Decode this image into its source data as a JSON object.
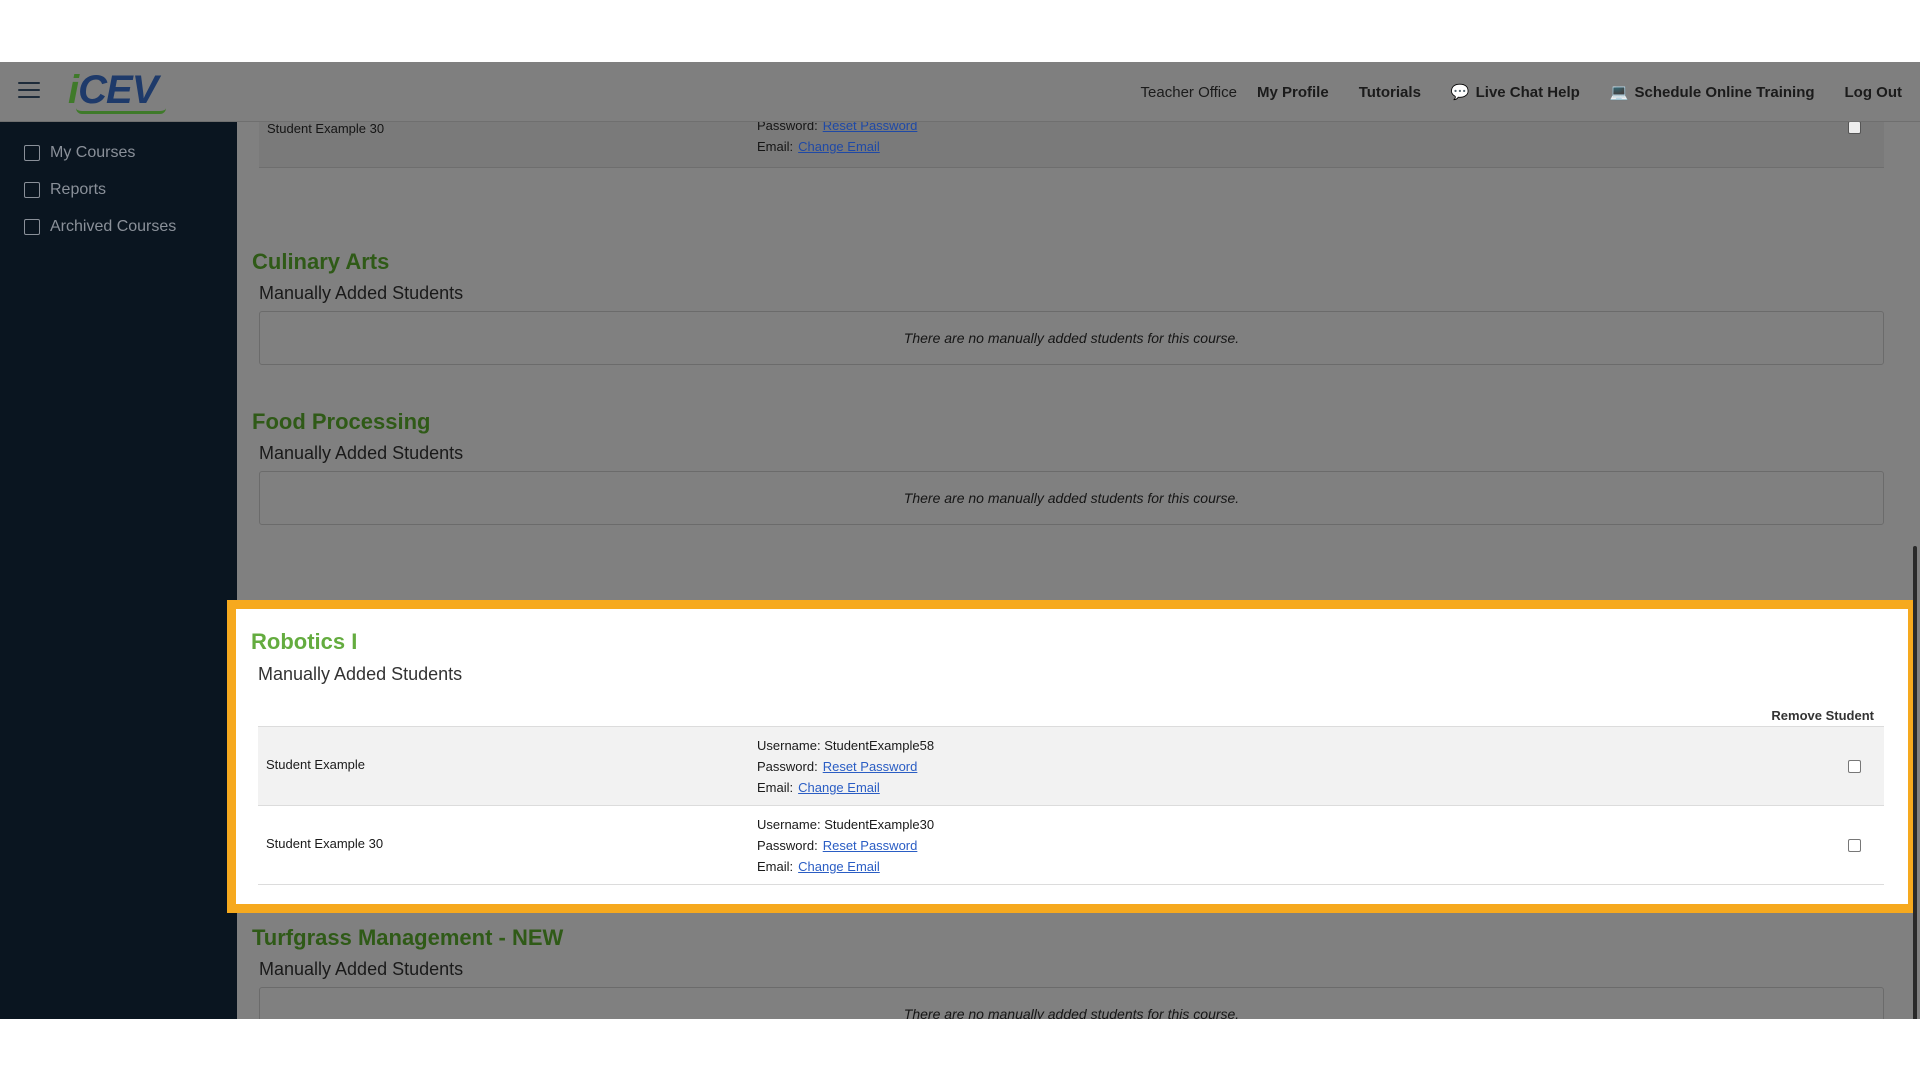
{
  "header": {
    "logo": "CEV",
    "logo_i": "i",
    "nav": {
      "teacher_office": "Teacher Office",
      "my_profile": "My Profile",
      "tutorials": "Tutorials",
      "live_chat": "Live Chat Help",
      "schedule_training": "Schedule Online Training",
      "log_out": "Log Out"
    }
  },
  "sidebar": {
    "items": [
      {
        "label": "My Courses",
        "icon": "home-icon"
      },
      {
        "label": "Reports",
        "icon": "chart-icon"
      },
      {
        "label": "Archived Courses",
        "icon": "archive-icon"
      }
    ]
  },
  "top_row": {
    "student": "Student Example 30",
    "password_label": "Password:",
    "reset_password": "Reset Password",
    "email_label": "Email:",
    "change_email": "Change Email"
  },
  "common": {
    "manually_added": "Manually Added Students",
    "no_students": "There are no manually added students for this course."
  },
  "sections": {
    "culinary": "Culinary Arts",
    "food": "Food Processing",
    "robotics": "Robotics I",
    "turfgrass": "Turfgrass Management - NEW"
  },
  "robotics": {
    "remove_header": "Remove Student",
    "rows": [
      {
        "name": "Student Example",
        "username": "Username: StudentExample58",
        "password_label": "Password:",
        "reset_password": "Reset Password",
        "email_label": "Email:",
        "change_email": "Change Email"
      },
      {
        "name": "Student Example 30",
        "username": "Username: StudentExample30",
        "password_label": "Password:",
        "reset_password": "Reset Password",
        "email_label": "Email:",
        "change_email": "Change Email"
      }
    ]
  },
  "colors": {
    "highlight": "#f6a91e",
    "title_green": "#64ac3f",
    "sidebar_bg": "#0a1520",
    "link": "#2a5dc4"
  }
}
